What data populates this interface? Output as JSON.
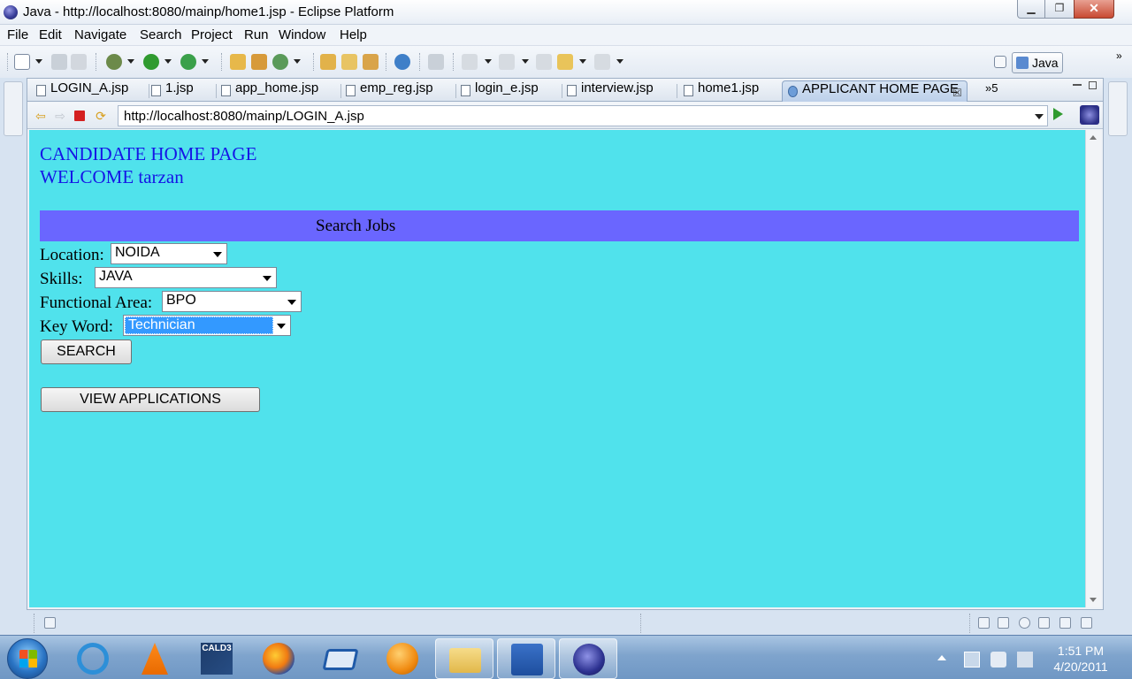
{
  "window": {
    "title": "Java - http://localhost:8080/mainp/home1.jsp - Eclipse Platform",
    "minimize_glyph": "▁",
    "maximize_glyph": "❐",
    "close_glyph": "✕"
  },
  "menu": [
    "File",
    "Edit",
    "Navigate",
    "Search",
    "Project",
    "Run",
    "Window",
    "Help"
  ],
  "perspective": {
    "label": "Java"
  },
  "tabs": [
    {
      "label": "LOGIN_A.jsp"
    },
    {
      "label": "1.jsp"
    },
    {
      "label": "app_home.jsp"
    },
    {
      "label": "emp_reg.jsp"
    },
    {
      "label": "login_e.jsp"
    },
    {
      "label": "interview.jsp"
    },
    {
      "label": "home1.jsp"
    },
    {
      "label": "APPLICANT HOME PAGE",
      "active": true
    }
  ],
  "tab_close_glyph": "☒",
  "tab_overflow": "»5",
  "browser": {
    "url": "http://localhost:8080/mainp/LOGIN_A.jsp"
  },
  "page": {
    "background": "#50e2ec",
    "heading": "CANDIDATE HOME PAGE",
    "welcome": "WELCOME tarzan",
    "search_bar_title": "Search Jobs",
    "search_bar_color": "#6a66ff",
    "fields": {
      "location": {
        "label": "Location:",
        "value": "NOIDA"
      },
      "skills": {
        "label": "Skills:",
        "value": "JAVA"
      },
      "functional_area": {
        "label": "Functional Area:",
        "value": "BPO"
      },
      "key_word": {
        "label": "Key Word:",
        "value": "Technician"
      }
    },
    "search_button": "SEARCH",
    "view_applications_button": "VIEW APPLICATIONS"
  },
  "taskbar": {
    "apps": [
      "internet-explorer-icon",
      "vlc-icon",
      "cald3-icon",
      "firefox-icon",
      "virtualbox-icon",
      "orb-icon",
      "explorer-folder-icon",
      "word-icon",
      "eclipse-icon"
    ],
    "cald3_label": "CALD3",
    "clock_time": "1:51 PM",
    "clock_date": "4/20/2011"
  }
}
